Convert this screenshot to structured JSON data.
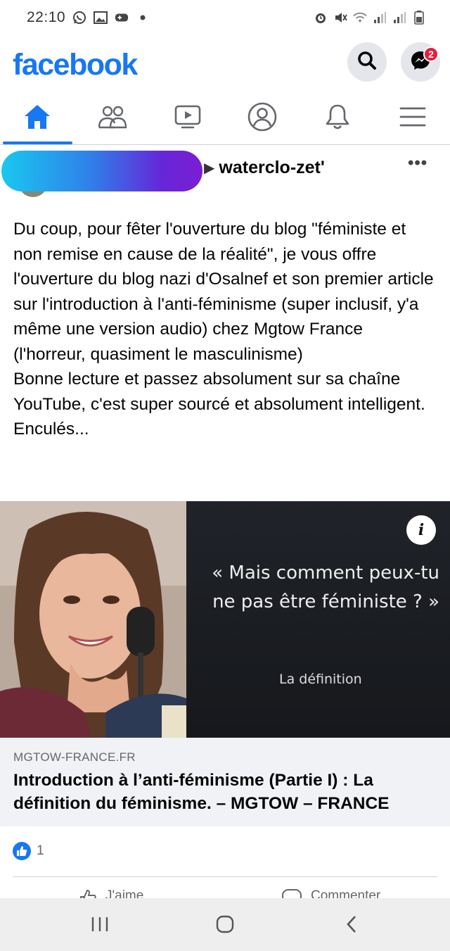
{
  "status_bar": {
    "time": "22:10",
    "left_icons": [
      "whatsapp-icon",
      "gallery-icon",
      "game-icon",
      "dot-icon"
    ],
    "right_icons": [
      "alarm-icon",
      "mute-icon",
      "wifi-icon",
      "signal-icon",
      "signal-icon",
      "battery-icon"
    ]
  },
  "header": {
    "logo": "facebook",
    "messenger_badge": "2"
  },
  "nav_tabs": [
    {
      "name": "home",
      "icon": "home-icon",
      "active": true
    },
    {
      "name": "friends",
      "icon": "friends-icon",
      "active": false
    },
    {
      "name": "watch",
      "icon": "watch-icon",
      "active": false
    },
    {
      "name": "profile",
      "icon": "profile-icon",
      "active": false
    },
    {
      "name": "notifications",
      "icon": "bell-icon",
      "active": false
    },
    {
      "name": "menu",
      "icon": "menu-icon",
      "active": false
    }
  ],
  "post": {
    "group_name": "waterclo-zet'",
    "more_label": "•••",
    "text_lines": [
      "Du coup, pour fêter l'ouverture du blog \"féministe et non remise en cause de la réalité\", je vous offre l'ouverture du blog nazi d'Osalnef et son premier article sur l'introduction à l'anti-féminisme (super inclusif, y'a même une version audio) chez Mgtow France (l'horreur, quasiment le masculinisme)",
      "Bonne lecture et passez absolument sur sa chaîne YouTube, c'est super sourcé et absolument intelligent.",
      "Enculés..."
    ]
  },
  "link_card": {
    "quote_line1": "« Mais comment peux-tu",
    "quote_line2": "ne pas être féministe ? »",
    "subtitle": "La définition",
    "info_label": "i",
    "domain": "MGTOW-FRANCE.FR",
    "title": "Introduction à l’anti-féminisme (Partie I) : La définition du féminisme. – MGTOW – FRANCE"
  },
  "reactions": {
    "count": "1"
  },
  "actions": {
    "like_label": "J'aime",
    "comment_label": "Commenter"
  },
  "colors": {
    "brand_blue": "#1877f2",
    "badge_red": "#e41e3f"
  }
}
